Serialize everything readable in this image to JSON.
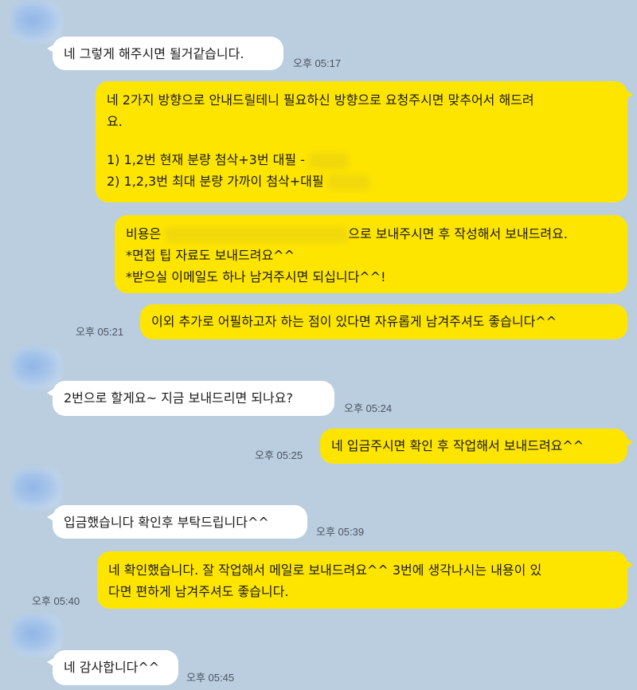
{
  "messages": [
    {
      "side": "in",
      "text": "네 그렇게 해주시면 될거같습니다.",
      "time": "오후 05:17"
    },
    {
      "side": "out",
      "lines": [
        "네 2가지 방향으로 안내드릴테니 필요하신 방향으로 요청주시면 맞추어서 해드려",
        "요.",
        "1) 1,2번 현재 분량 첨삭+3번 대필 -",
        "2) 1,2,3번 최대 분량 가까이 첨삭+대필"
      ]
    },
    {
      "side": "out",
      "lines": [
        "비용은",
        "으로 보내주시면 후 작성해서 보내드려요.",
        "*면접 팁 자료도 보내드려요^^",
        "*받으실 이메일도 하나 남겨주시면 되십니다^^!"
      ]
    },
    {
      "side": "out",
      "text": "이외 추가로 어필하고자 하는 점이 있다면 자유롭게 남겨주셔도 좋습니다^^",
      "time": "오후 05:21"
    },
    {
      "side": "in",
      "text": "2번으로 할게요~ 지금 보내드리면 되나요?",
      "time": "오후 05:24"
    },
    {
      "side": "out",
      "text": "네 입금주시면 확인 후 작업해서 보내드려요^^",
      "time": "오후 05:25"
    },
    {
      "side": "in",
      "text": "입금했습니다 확인후 부탁드립니다^^",
      "time": "오후 05:39"
    },
    {
      "side": "out",
      "lines": [
        "네 확인했습니다. 잘 작업해서 메일로 보내드려요^^ 3번에 생각나시는 내용이 있",
        "다면 편하게 남겨주셔도 좋습니다."
      ],
      "time": "오후 05:40"
    },
    {
      "side": "in",
      "text": "네 감사합니다^^",
      "time": "오후 05:45"
    }
  ]
}
